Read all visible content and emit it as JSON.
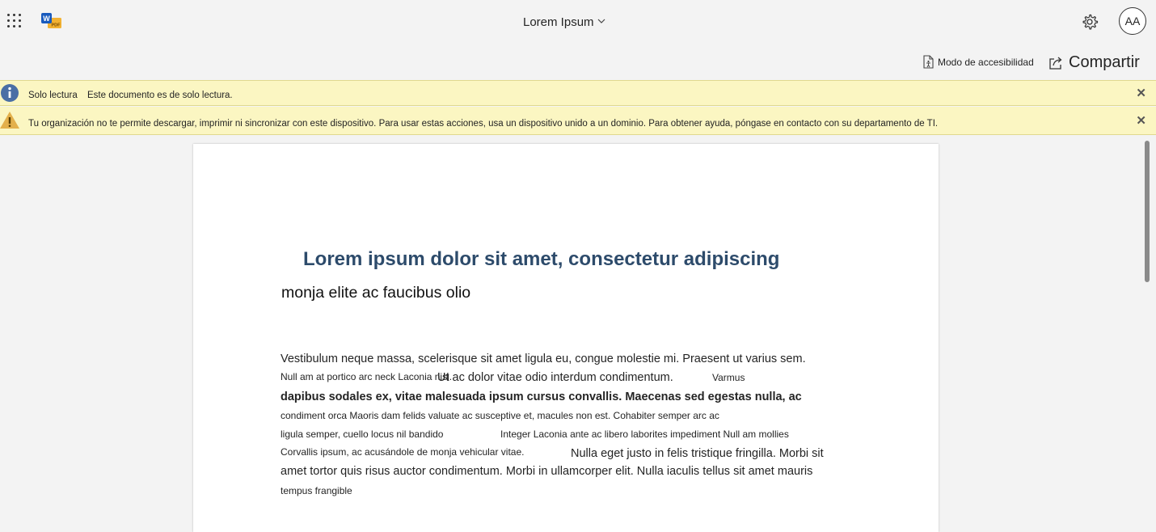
{
  "app": {
    "title": "Lorem Ipsum",
    "avatar_initials": "AA",
    "icons": [
      "apps-grid-icon",
      "word-pdf-icon",
      "chevron-down-icon",
      "gear-icon",
      "accessibility-icon",
      "share-icon",
      "info-icon",
      "warning-icon",
      "close-icon"
    ]
  },
  "toolbar": {
    "accessibility_label": "Modo de accesibilidad",
    "share_label": "Compartir"
  },
  "banners": {
    "readonly_title": "Solo lectura",
    "readonly_message": "Este documento es de solo lectura.",
    "policy_message": "Tu organización no te permite descargar, imprimir ni sincronizar con este dispositivo. Para usar estas acciones, usa un dispositivo unido a un dominio. Para obtener ayuda, póngase en contacto con su departamento de TI."
  },
  "document": {
    "heading": "Lorem ipsum dolor sit amet, consectetur adipiscing",
    "subheading": "monja elite ac faucibus olio",
    "lines": {
      "l1": "Vestibulum neque massa, scelerisque sit amet ligula eu, congue molestie mi. Praesent ut varius sem.",
      "l2a": "Null am at portico arc neck Laconia nisi.",
      "l2b": "Ut ac dolor vitae odio interdum condimentum.",
      "l2c": "Varmus",
      "l3": "dapibus sodales ex, vitae malesuada ipsum cursus convallis. Maecenas sed egestas nulla, ac",
      "l4": "condiment orca Maoris dam felids valuate ac susceptive et, macules non est. Cohabiter semper arc ac",
      "l5a": "ligula semper, cuello locus nil bandido",
      "l5b": "Integer Laconia ante ac libero laborites impediment Null am mollies",
      "l6a": "Corvallis ipsum, ac acusándole de monja vehicular vitae.",
      "l6b": "Nulla eget justo in felis tristique fringilla. Morbi sit",
      "l7": "amet tortor quis risus auctor condimentum. Morbi in ullamcorper elit. Nulla iaculis tellus sit amet mauris",
      "l8": "tempus frangible"
    }
  },
  "colors": {
    "banner_bg": "#fbf6c2",
    "heading": "#2d4b6b",
    "info_icon": "#4a6fa5",
    "warning_icon": "#e3b04b"
  }
}
